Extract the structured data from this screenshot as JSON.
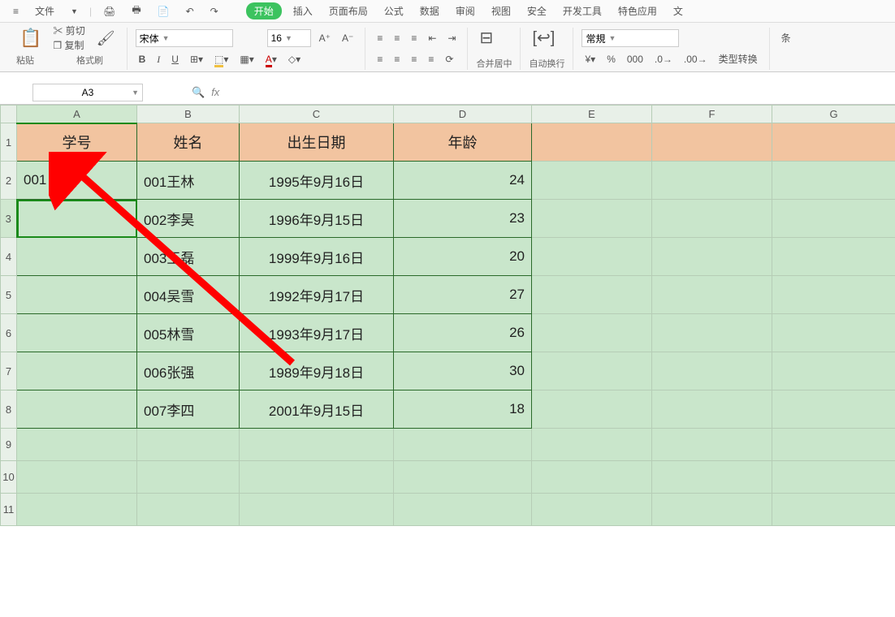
{
  "top": {
    "file": "文件",
    "tabs": [
      "开始",
      "插入",
      "页面布局",
      "公式",
      "数据",
      "审阅",
      "视图",
      "安全",
      "开发工具",
      "特色应用",
      "文"
    ]
  },
  "clipboard": {
    "paste": "粘贴",
    "cut": "剪切",
    "copy": "复制",
    "format": "格式刷"
  },
  "font": {
    "name": "宋体",
    "size": "16",
    "bold": "B",
    "italic": "I",
    "underline": "U"
  },
  "align": {
    "merge": "合并居中",
    "wrap": "自动换行"
  },
  "number": {
    "format": "常規",
    "pct": "%",
    "comma": "000",
    "dec_inc": ".0",
    "dec_dec": ".00",
    "type": "类型转换"
  },
  "more": "条",
  "namebox": "A3",
  "fx": "fx",
  "cols": [
    "A",
    "B",
    "C",
    "D",
    "E",
    "F",
    "G"
  ],
  "rows": [
    "1",
    "2",
    "3",
    "4",
    "5",
    "6",
    "7",
    "8",
    "9",
    "10",
    "11"
  ],
  "headers": {
    "a": "学号",
    "b": "姓名",
    "c": "出生日期",
    "d": "年龄"
  },
  "data": [
    {
      "a": "001",
      "b": "001王林",
      "c": "1995年9月16日",
      "d": "24"
    },
    {
      "a": "",
      "b": "002李昊",
      "c": "1996年9月15日",
      "d": "23"
    },
    {
      "a": "",
      "b": "003王磊",
      "c": "1999年9月16日",
      "d": "20"
    },
    {
      "a": "",
      "b": "004吴雪",
      "c": "1992年9月17日",
      "d": "27"
    },
    {
      "a": "",
      "b": "005林雪",
      "c": "1993年9月17日",
      "d": "26"
    },
    {
      "a": "",
      "b": "006张强",
      "c": "1989年9月18日",
      "d": "30"
    },
    {
      "a": "",
      "b": "007李四",
      "c": "2001年9月15日",
      "d": "18"
    }
  ],
  "icons": {
    "search": "🔍"
  },
  "colors": {
    "accent": "#3cc35f",
    "header_bg": "#f2c4a0",
    "sheet_bg": "#c9e6cb",
    "border": "#2a6a2a",
    "arrow": "#ff0000"
  }
}
